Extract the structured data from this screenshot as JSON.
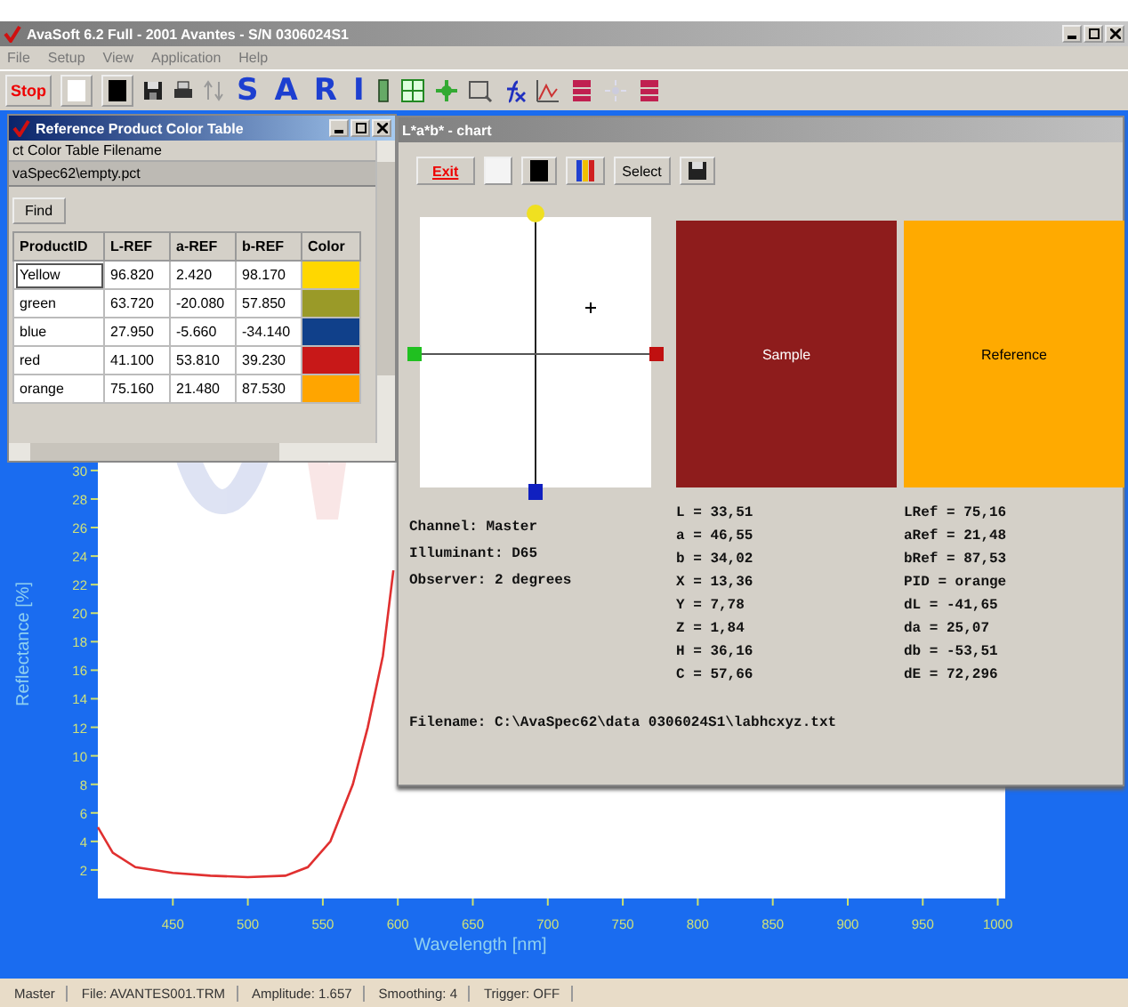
{
  "window": {
    "title": "AvaSoft 6.2 Full - 2001 Avantes - S/N 0306024S1"
  },
  "menu": [
    "File",
    "Setup",
    "View",
    "Application",
    "Help"
  ],
  "toolbar": {
    "stop": "Stop",
    "letters": [
      "S",
      "A",
      "R",
      "I"
    ]
  },
  "graph": {
    "chart_data": {
      "type": "line",
      "xlabel": "Wavelength [nm]",
      "ylabel": "Reflectance [%]",
      "xlim": [
        400,
        1005
      ],
      "ylim": [
        0,
        54
      ],
      "xticks": [
        450,
        500,
        550,
        600,
        650,
        700,
        750,
        800,
        850,
        900,
        950,
        1000
      ],
      "yticks": [
        2,
        4,
        6,
        8,
        10,
        12,
        14,
        16,
        18,
        20,
        22,
        24,
        26,
        28,
        30
      ],
      "x": [
        400,
        410,
        425,
        450,
        475,
        500,
        525,
        540,
        555,
        570,
        580,
        590,
        597
      ],
      "series": [
        {
          "color": "#e03030",
          "values": [
            5,
            3.2,
            2.2,
            1.8,
            1.6,
            1.5,
            1.6,
            2.2,
            4,
            8,
            12,
            17,
            23
          ]
        }
      ]
    }
  },
  "reference_window": {
    "title": "Reference Product Color Table",
    "filename_label": "ct Color Table Filename",
    "filename_value": "vaSpec62\\empty.pct",
    "find_button": "Find",
    "columns": [
      "ProductID",
      "L-REF",
      "a-REF",
      "b-REF",
      "Color"
    ],
    "rows": [
      {
        "product_id": "Yellow",
        "l_ref": "96.820",
        "a_ref": "2.420",
        "b_ref": "98.170",
        "color": "#ffd700"
      },
      {
        "product_id": "green",
        "l_ref": "63.720",
        "a_ref": "-20.080",
        "b_ref": "57.850",
        "color": "#9a9a28"
      },
      {
        "product_id": "blue",
        "l_ref": "27.950",
        "a_ref": "-5.660",
        "b_ref": "-34.140",
        "color": "#10408a"
      },
      {
        "product_id": "red",
        "l_ref": "41.100",
        "a_ref": "53.810",
        "b_ref": "39.230",
        "color": "#c81818"
      },
      {
        "product_id": "orange",
        "l_ref": "75.160",
        "a_ref": "21.480",
        "b_ref": "87.530",
        "color": "#ffa500"
      }
    ]
  },
  "chart_window": {
    "title": "L*a*b* - chart",
    "exit_button": "Exit",
    "select_button": "Select",
    "patches": [
      {
        "label": "Sample",
        "color": "#8e1c1c"
      },
      {
        "label": "Reference",
        "color": "#ffaa00"
      }
    ],
    "info": [
      "Channel: Master",
      "Illuminant: D65",
      "Observer: 2  degrees"
    ],
    "sample_values": [
      "L = 33,51",
      "a = 46,55",
      "b = 34,02",
      "X = 13,36",
      "Y = 7,78",
      "Z = 1,84",
      "H = 36,16",
      "C = 57,66"
    ],
    "reference_values": [
      "LRef = 75,16",
      "aRef = 21,48",
      "bRef = 87,53",
      "PID  = orange",
      "dL = -41,65",
      "da = 25,07",
      "db = -53,51",
      "dE = 72,296"
    ],
    "filename": "Filename: C:\\AvaSpec62\\data 0306024S1\\labhcxyz.txt"
  },
  "status_bar": [
    "Master",
    "File: AVANTES001.TRM",
    "Amplitude: 1.657",
    "Smoothing: 4",
    "Trigger: OFF"
  ]
}
